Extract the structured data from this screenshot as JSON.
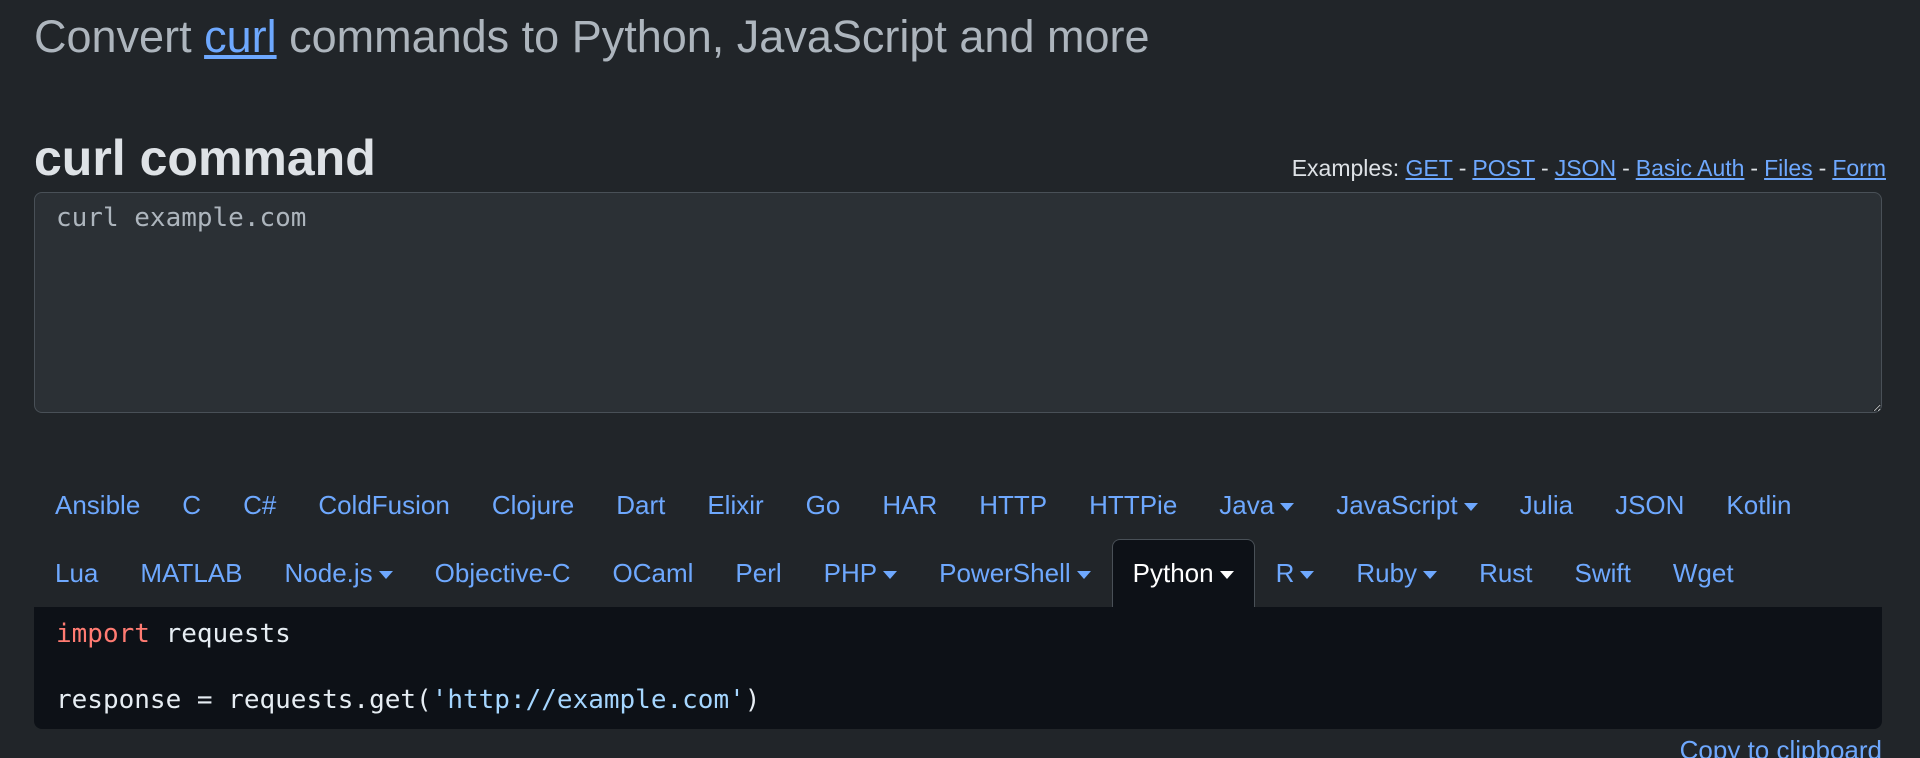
{
  "heading": {
    "prefix": "Convert ",
    "link": "curl",
    "suffix": " commands to Python, JavaScript and more"
  },
  "curl_section": {
    "title": "curl command",
    "examples_label": "Examples:",
    "examples": [
      "GET",
      "POST",
      "JSON",
      "Basic Auth",
      "Files",
      "Form"
    ],
    "separator": "-",
    "input_value": "curl example.com"
  },
  "tabs": {
    "row1": [
      {
        "label": "Ansible",
        "dropdown": false
      },
      {
        "label": "C",
        "dropdown": false
      },
      {
        "label": "C#",
        "dropdown": false
      },
      {
        "label": "ColdFusion",
        "dropdown": false
      },
      {
        "label": "Clojure",
        "dropdown": false
      },
      {
        "label": "Dart",
        "dropdown": false
      },
      {
        "label": "Elixir",
        "dropdown": false
      },
      {
        "label": "Go",
        "dropdown": false
      },
      {
        "label": "HAR",
        "dropdown": false
      },
      {
        "label": "HTTP",
        "dropdown": false
      },
      {
        "label": "HTTPie",
        "dropdown": false
      },
      {
        "label": "Java",
        "dropdown": true
      },
      {
        "label": "JavaScript",
        "dropdown": true
      },
      {
        "label": "Julia",
        "dropdown": false
      },
      {
        "label": "JSON",
        "dropdown": false
      },
      {
        "label": "Kotlin",
        "dropdown": false
      }
    ],
    "row2": [
      {
        "label": "Lua",
        "dropdown": false
      },
      {
        "label": "MATLAB",
        "dropdown": false
      },
      {
        "label": "Node.js",
        "dropdown": true
      },
      {
        "label": "Objective-C",
        "dropdown": false
      },
      {
        "label": "OCaml",
        "dropdown": false
      },
      {
        "label": "Perl",
        "dropdown": false
      },
      {
        "label": "PHP",
        "dropdown": true
      },
      {
        "label": "PowerShell",
        "dropdown": true
      },
      {
        "label": "Python",
        "dropdown": true,
        "active": true
      },
      {
        "label": "R",
        "dropdown": true
      },
      {
        "label": "Ruby",
        "dropdown": true
      },
      {
        "label": "Rust",
        "dropdown": false
      },
      {
        "label": "Swift",
        "dropdown": false
      },
      {
        "label": "Wget",
        "dropdown": false
      }
    ]
  },
  "code": {
    "line1_keyword": "import",
    "line1_rest": " requests",
    "line3_prefix": "response = requests.get(",
    "line3_string": "'http://example.com'",
    "line3_suffix": ")"
  },
  "copy_label": "Copy to clipboard",
  "colors": {
    "background": "#212529",
    "link": "#6ea8fe",
    "code_background": "#0d1117",
    "keyword": "#ff7b72",
    "string": "#a5d6ff"
  }
}
